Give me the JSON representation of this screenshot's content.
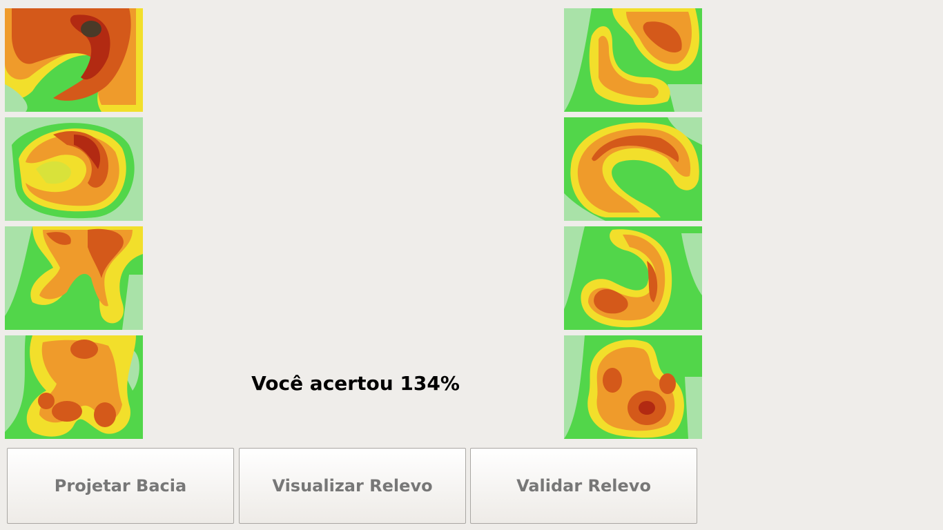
{
  "score": {
    "text": "Você acertou 134%"
  },
  "buttons": {
    "design_basin": "Projetar Bacia",
    "view_relief": "Visualizar Relevo",
    "validate_relief": "Validar Relevo"
  },
  "colors": {
    "background": "#efedea",
    "low_pale": "#a9e2a8",
    "green": "#52d64a",
    "yellow": "#f2df2b",
    "orange": "#ef9b2b",
    "dark_orange": "#d4591a",
    "red": "#b22a12",
    "peak": "#4a3a28",
    "button_text": "#777777"
  },
  "left_column_maps": [
    "relief-map-1",
    "relief-map-2",
    "relief-map-3",
    "relief-map-4"
  ],
  "right_column_maps": [
    "relief-map-5",
    "relief-map-6",
    "relief-map-7",
    "relief-map-8"
  ]
}
